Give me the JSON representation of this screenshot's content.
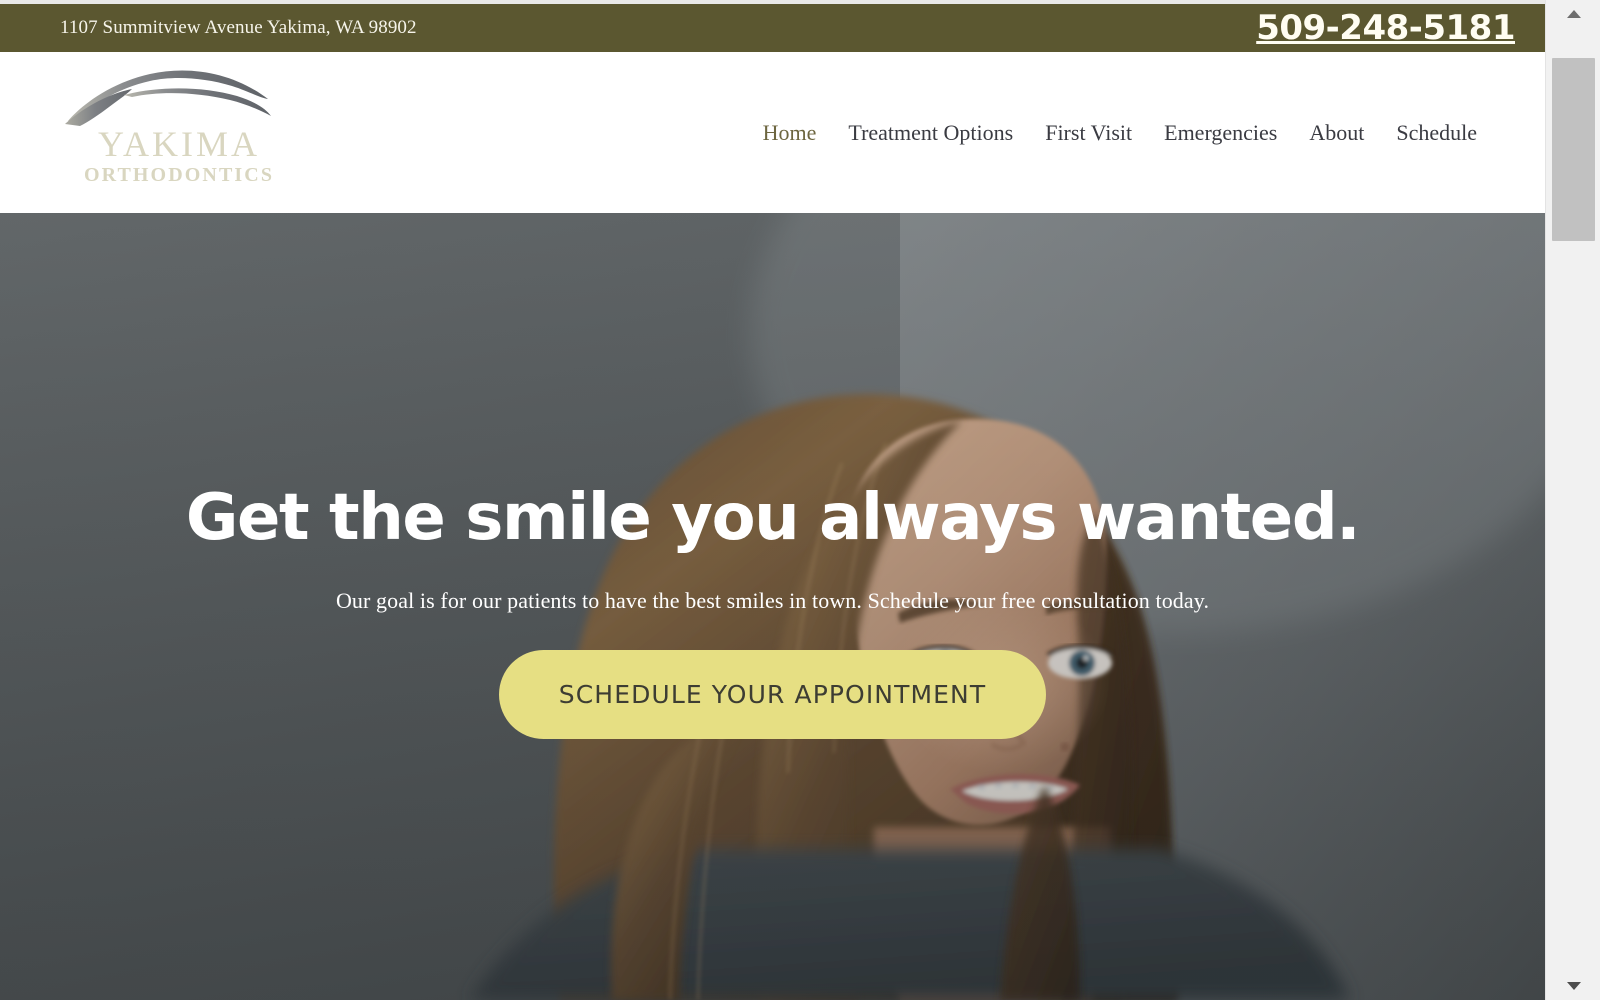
{
  "utility_bar": {
    "address": "1107 Summitview Avenue Yakima, WA 98902",
    "phone": "509-248-5181",
    "background_color": "#5b5730",
    "text_color": "#f6f4ea"
  },
  "logo": {
    "name_top": "YAKIMA",
    "name_bottom": "ORTHODONTICS",
    "swoosh_icon": "brush-arc-icon",
    "wordmark_color": "#d9d6c0",
    "swoosh_color": "#6f7277"
  },
  "nav": {
    "items": [
      {
        "label": "Home",
        "active": true
      },
      {
        "label": "Treatment Options",
        "active": false
      },
      {
        "label": "First Visit",
        "active": false
      },
      {
        "label": "Emergencies",
        "active": false
      },
      {
        "label": "About",
        "active": false
      },
      {
        "label": "Schedule",
        "active": false
      }
    ],
    "active_color": "#6d6640",
    "text_color": "#3a3b42"
  },
  "hero": {
    "heading": "Get the smile you always wanted.",
    "subheading": "Our goal is for our patients to have the best smiles in town. Schedule your free consultation today.",
    "cta_label": "SCHEDULE YOUR APPOINTMENT",
    "cta_background": "#e6df83",
    "cta_text_color": "#3d3d33",
    "background_color": "#5d6264",
    "image_description": "Smiling young woman with long brown hair wearing braces, gray studio backdrop"
  },
  "scrollbar": {
    "up_arrow_icon": "chevron-up-icon",
    "down_arrow_icon": "chevron-down-icon",
    "track_color": "#f1f1f1",
    "thumb_color": "#c1c1c1"
  }
}
